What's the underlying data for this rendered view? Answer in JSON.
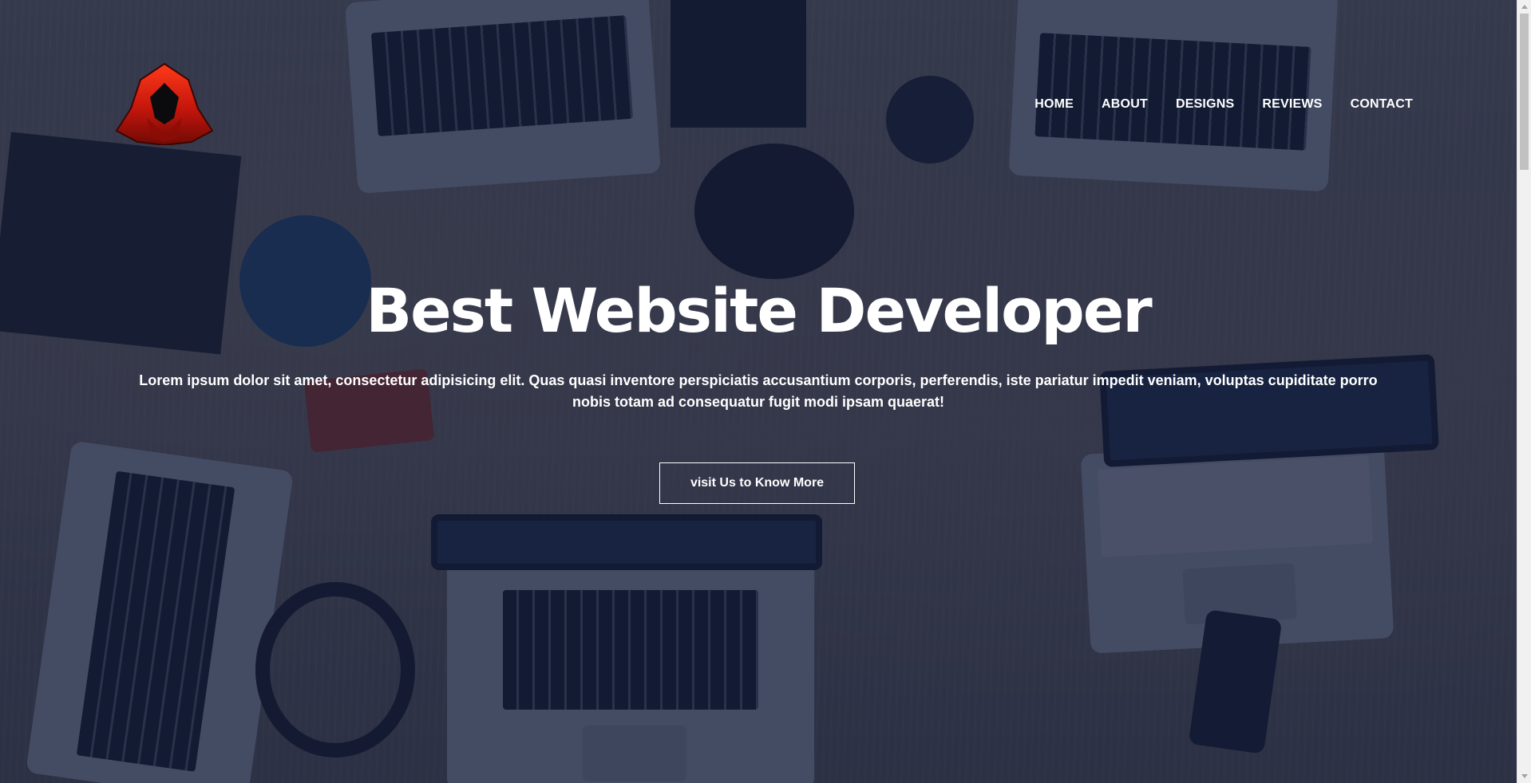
{
  "page": {
    "background_description_color": "#111b3a",
    "accent_color": "#c4160c"
  },
  "logo": {
    "icon": "hooded-figure-icon"
  },
  "nav": {
    "items": [
      {
        "label": "HOME"
      },
      {
        "label": "ABOUT"
      },
      {
        "label": "DESIGNS"
      },
      {
        "label": "REVIEWS"
      },
      {
        "label": "CONTACT"
      }
    ]
  },
  "hero": {
    "title": "Best Website Developer",
    "text": "Lorem ipsum dolor sit amet, consectetur adipisicing elit. Quas quasi inventore perspiciatis accusantium corporis, perferendis, iste pariatur impedit veniam, voluptas cupiditate porro nobis totam ad consequatur fugit modi ipsam quaerat!",
    "button_label": "visit Us to Know More"
  },
  "scrollbar": {
    "up_icon": "arrow-up-icon",
    "down_icon": "arrow-down-icon"
  }
}
